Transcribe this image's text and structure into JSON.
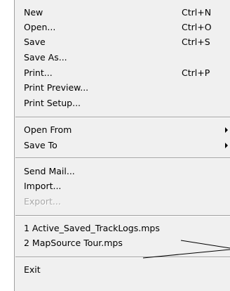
{
  "menu": {
    "new": {
      "label": "New",
      "shortcut": "Ctrl+N"
    },
    "open": {
      "label": "Open...",
      "shortcut": "Ctrl+O"
    },
    "save": {
      "label": "Save",
      "shortcut": "Ctrl+S"
    },
    "save_as": {
      "label": "Save As..."
    },
    "print": {
      "label": "Print...",
      "shortcut": "Ctrl+P"
    },
    "print_preview": {
      "label": "Print Preview..."
    },
    "print_setup": {
      "label": "Print Setup..."
    },
    "open_from": {
      "label": "Open From"
    },
    "save_to": {
      "label": "Save To"
    },
    "send_mail": {
      "label": "Send Mail..."
    },
    "import": {
      "label": "Import..."
    },
    "export": {
      "label": "Export..."
    },
    "recent_1": {
      "label": "1 Active_Saved_TrackLogs.mps"
    },
    "recent_2": {
      "label": "2 MapSource Tour.mps"
    },
    "exit": {
      "label": "Exit"
    }
  },
  "colors": {
    "menu_background": "#f0f0f0",
    "disabled_text": "#a9a9a9",
    "separator": "#a0a0a0"
  },
  "icons": {
    "submenu": "submenu-arrow-icon"
  }
}
